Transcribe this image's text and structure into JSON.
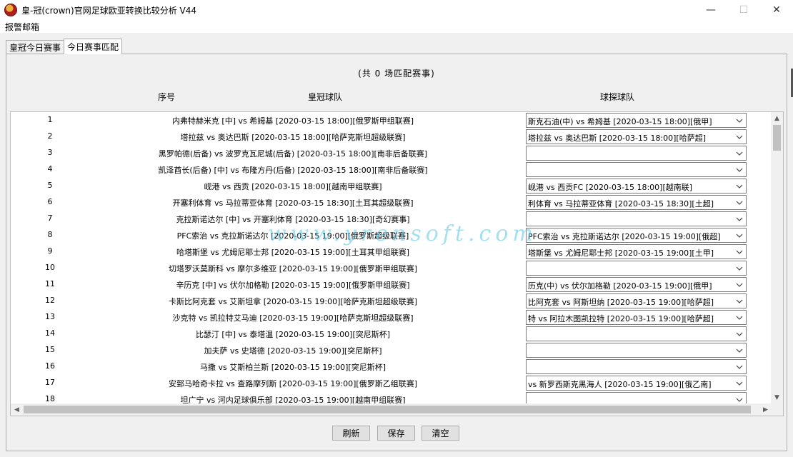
{
  "window": {
    "title": "皇-冠(crown)官网足球欧亚转换比较分析 V44",
    "minimize_glyph": "—",
    "maximize_glyph": "☐",
    "close_glyph": "✕"
  },
  "menu": {
    "items": [
      "报警邮箱"
    ]
  },
  "tabs": [
    {
      "label": "皇冠今日赛事",
      "active": false
    },
    {
      "label": "今日赛事匹配",
      "active": true
    }
  ],
  "summary": "(共  0  场匹配赛事)",
  "columns": {
    "seq": "序号",
    "crown": "皇冠球队",
    "qiutan": "球探球队"
  },
  "rows": [
    {
      "num": "1",
      "crown": "内弗特赫米克 [中] vs 希姆基 [2020-03-15 18:00][俄罗斯甲组联赛]",
      "qiutan": "斯克石油(中) vs 希姆基 [2020-03-15 18:00][俄甲]"
    },
    {
      "num": "2",
      "crown": "塔拉兹 vs 奥达巴斯 [2020-03-15 18:00][哈萨克斯坦超级联赛]",
      "qiutan": "塔拉兹 vs 奥达巴斯 [2020-03-15 18:00][哈萨超]"
    },
    {
      "num": "3",
      "crown": "黑罗帕德(后备) vs 波罗克瓦尼城(后备) [2020-03-15 18:00][南非后备联赛]",
      "qiutan": ""
    },
    {
      "num": "4",
      "crown": "凯泽酋长(后备) [中] vs 布隆方丹(后备) [2020-03-15 18:00][南非后备联赛]",
      "qiutan": ""
    },
    {
      "num": "5",
      "crown": "岘港 vs 西贡 [2020-03-15 18:00][越南甲组联赛]",
      "qiutan": "岘港 vs 西贡FC [2020-03-15 18:00][越南联]"
    },
    {
      "num": "6",
      "crown": "开塞利体育 vs 马拉蒂亚体育 [2020-03-15 18:30][土耳其超级联赛]",
      "qiutan": "利体育 vs 马拉蒂亚体育 [2020-03-15 18:30][土超]"
    },
    {
      "num": "7",
      "crown": "克拉斯诺达尔 [中] vs 开塞利体育 [2020-03-15 18:30][奇幻赛事]",
      "qiutan": ""
    },
    {
      "num": "8",
      "crown": "PFC索治 vs 克拉斯诺达尔 [2020-03-15 19:00][俄罗斯超级联赛]",
      "qiutan": "PFC索治 vs 克拉斯诺达尔 [2020-03-15 19:00][俄超]"
    },
    {
      "num": "9",
      "crown": "哈塔斯堡 vs 尤姆尼耶士邦 [2020-03-15 19:00][土耳其甲组联赛]",
      "qiutan": "塔斯堡 vs 尤姆尼耶士邦 [2020-03-15 19:00][土甲]"
    },
    {
      "num": "10",
      "crown": "切塔罗沃莫斯科 vs 摩尔多维亚 [2020-03-15 19:00][俄罗斯甲组联赛]",
      "qiutan": ""
    },
    {
      "num": "11",
      "crown": "辛历克 [中] vs 伏尔加格勒 [2020-03-15 19:00][俄罗斯甲组联赛]",
      "qiutan": "历克(中) vs 伏尔加格勒 [2020-03-15 19:00][俄甲]"
    },
    {
      "num": "12",
      "crown": "卡斯比阿克套 vs 艾斯坦拿 [2020-03-15 19:00][哈萨克斯坦超级联赛]",
      "qiutan": "比阿克套 vs 阿斯坦纳 [2020-03-15 19:00][哈萨超]"
    },
    {
      "num": "13",
      "crown": "沙克特 vs 凯拉特艾马迪 [2020-03-15 19:00][哈萨克斯坦超级联赛]",
      "qiutan": "特 vs 阿拉木图凯拉特 [2020-03-15 19:00][哈萨超]"
    },
    {
      "num": "14",
      "crown": "比瑟汀 [中] vs 泰塔温 [2020-03-15 19:00][突尼斯杯]",
      "qiutan": ""
    },
    {
      "num": "15",
      "crown": "加夫萨 vs 史塔德 [2020-03-15 19:00][突尼斯杯]",
      "qiutan": ""
    },
    {
      "num": "16",
      "crown": "马撒 vs 艾斯柏兰斯 [2020-03-15 19:00][突尼斯杯]",
      "qiutan": ""
    },
    {
      "num": "17",
      "crown": "安郅马哈奇卡拉 vs 查路摩列斯 [2020-03-15 19:00][俄罗斯乙组联赛]",
      "qiutan": "vs 新罗西斯克黑海人 [2020-03-15 19:00][俄乙南]"
    },
    {
      "num": "18",
      "crown": "坦广宁 vs 河内足球俱乐部 [2020-03-15 19:00][越南甲组联赛]",
      "qiutan": ""
    }
  ],
  "buttons": {
    "refresh": "刷新",
    "save": "保存",
    "clear": "清空"
  },
  "watermark": "www.yrensoft.com"
}
